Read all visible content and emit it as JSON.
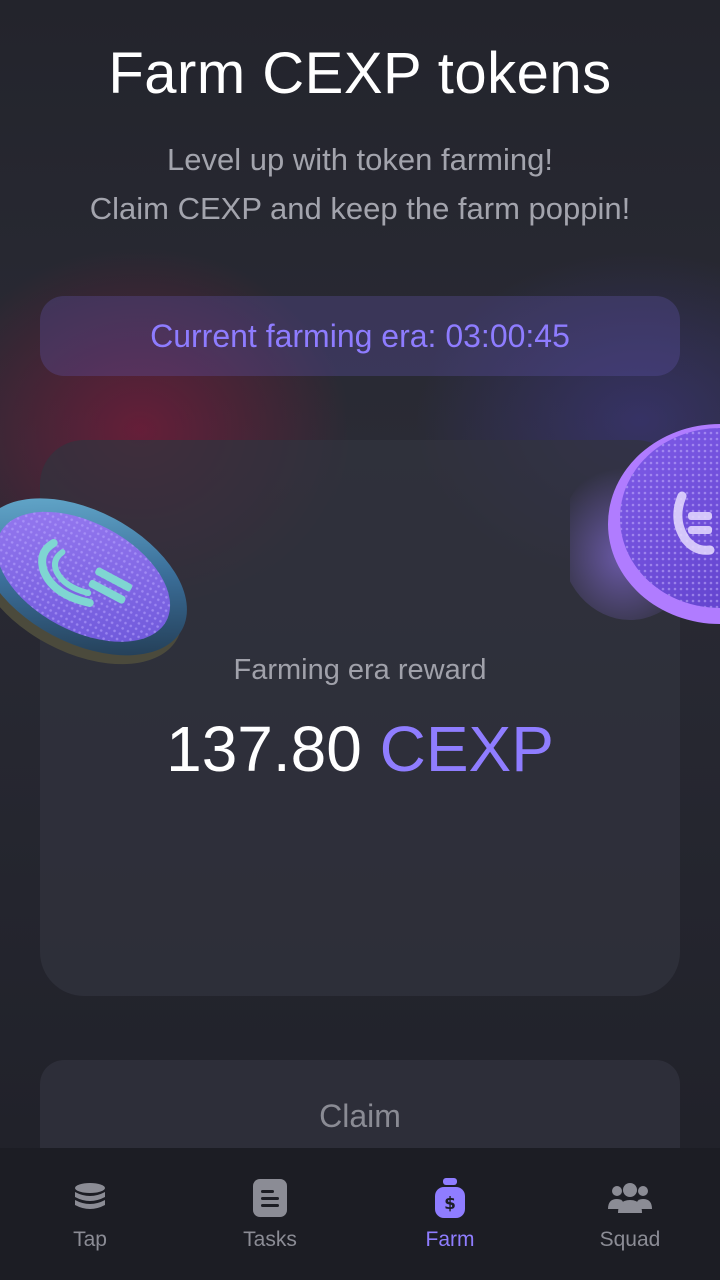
{
  "header": {
    "title": "Farm CEXP tokens",
    "subtitle_line1": "Level up with token farming!",
    "subtitle_line2": "Claim CEXP and keep the farm poppin!"
  },
  "era": {
    "label": "Current farming era:",
    "timer": "03:00:45"
  },
  "reward": {
    "label": "Farming era reward",
    "amount": "137.80",
    "unit": "CEXP"
  },
  "claim": {
    "label": "Claim"
  },
  "nav": {
    "items": [
      {
        "label": "Tap",
        "icon": "coins-stack-icon",
        "active": false
      },
      {
        "label": "Tasks",
        "icon": "document-icon",
        "active": false
      },
      {
        "label": "Farm",
        "icon": "money-bag-icon",
        "active": true
      },
      {
        "label": "Squad",
        "icon": "users-icon",
        "active": false
      }
    ]
  },
  "colors": {
    "accent": "#8f7dff",
    "background": "#1f2028",
    "card": "#32333e",
    "text_muted": "#a3a4ad"
  }
}
